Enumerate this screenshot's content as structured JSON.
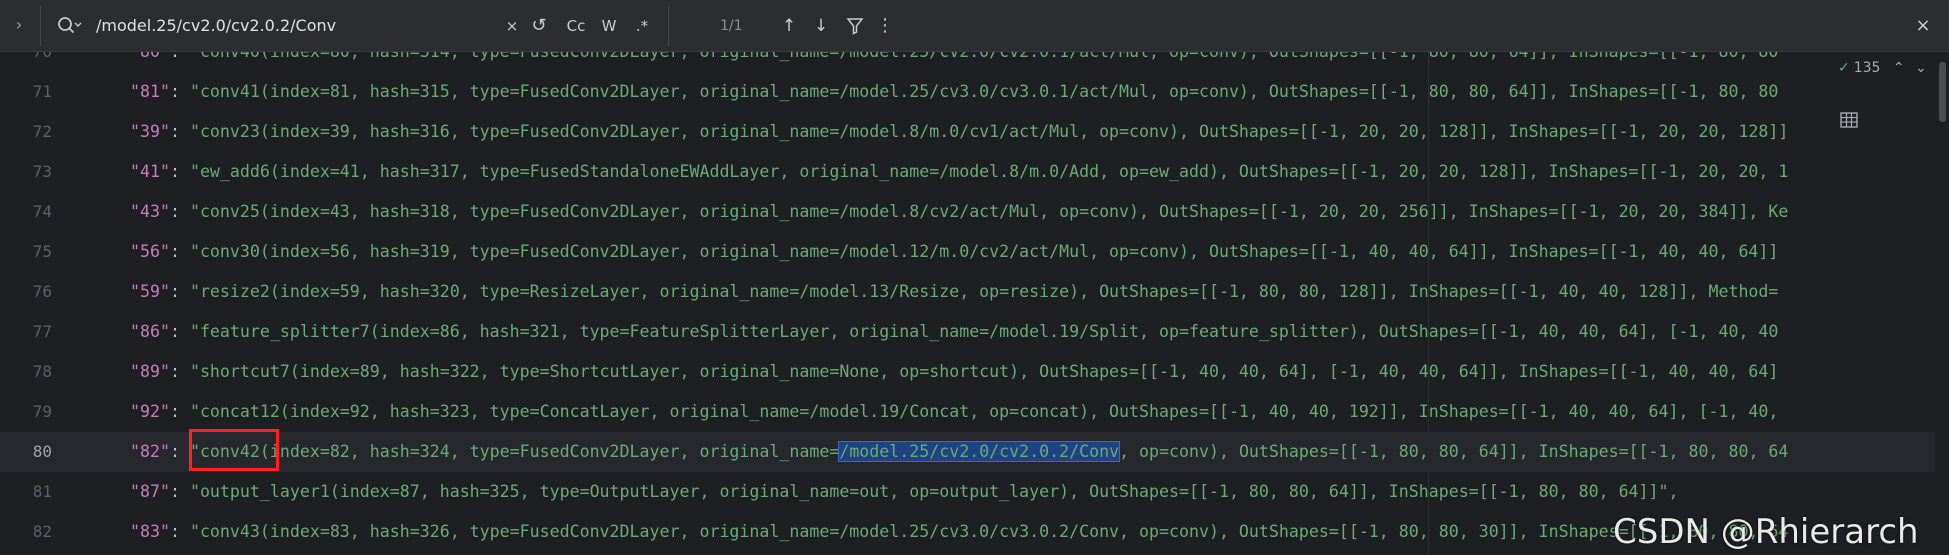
{
  "search": {
    "query": "/model.25/cv2.0/cv2.0.2/Conv",
    "clear_label": "×",
    "replace_label": "↺",
    "case_label": "Cc",
    "word_label": "W",
    "regex_label": ".*",
    "match_count": "1/1",
    "prev_label": "↑",
    "next_label": "↓",
    "filter_label": "⚲",
    "more_label": "⋮",
    "close_label": "×",
    "toggle_label": "›"
  },
  "inspection": {
    "count": "135"
  },
  "lines": [
    {
      "n": "70",
      "key": "\"80\"",
      "val": "\"conv40(index=80, hash=314, type=FusedConv2DLayer, original_name=/model.25/cv2.0/cv2.0.1/act/Mul, op=conv), OutShapes=[[-1, 80, 80, 64]], InShapes=[[-1, 80, 80"
    },
    {
      "n": "71",
      "key": "\"81\"",
      "val": "\"conv41(index=81, hash=315, type=FusedConv2DLayer, original_name=/model.25/cv3.0/cv3.0.1/act/Mul, op=conv), OutShapes=[[-1, 80, 80, 64]], InShapes=[[-1, 80, 80"
    },
    {
      "n": "72",
      "key": "\"39\"",
      "val": "\"conv23(index=39, hash=316, type=FusedConv2DLayer, original_name=/model.8/m.0/cv1/act/Mul, op=conv), OutShapes=[[-1, 20, 20, 128]], InShapes=[[-1, 20, 20, 128]]"
    },
    {
      "n": "73",
      "key": "\"41\"",
      "val": "\"ew_add6(index=41, hash=317, type=FusedStandaloneEWAddLayer, original_name=/model.8/m.0/Add, op=ew_add), OutShapes=[[-1, 20, 20, 128]], InShapes=[[-1, 20, 20, 1"
    },
    {
      "n": "74",
      "key": "\"43\"",
      "val": "\"conv25(index=43, hash=318, type=FusedConv2DLayer, original_name=/model.8/cv2/act/Mul, op=conv), OutShapes=[[-1, 20, 20, 256]], InShapes=[[-1, 20, 20, 384]], Ke"
    },
    {
      "n": "75",
      "key": "\"56\"",
      "val": "\"conv30(index=56, hash=319, type=FusedConv2DLayer, original_name=/model.12/m.0/cv2/act/Mul, op=conv), OutShapes=[[-1, 40, 40, 64]], InShapes=[[-1, 40, 40, 64]]"
    },
    {
      "n": "76",
      "key": "\"59\"",
      "val": "\"resize2(index=59, hash=320, type=ResizeLayer, original_name=/model.13/Resize, op=resize), OutShapes=[[-1, 80, 80, 128]], InShapes=[[-1, 40, 40, 128]], Method="
    },
    {
      "n": "77",
      "key": "\"86\"",
      "val": "\"feature_splitter7(index=86, hash=321, type=FeatureSplitterLayer, original_name=/model.19/Split, op=feature_splitter), OutShapes=[[-1, 40, 40, 64], [-1, 40, 40"
    },
    {
      "n": "78",
      "key": "\"89\"",
      "val": "\"shortcut7(index=89, hash=322, type=ShortcutLayer, original_name=None, op=shortcut), OutShapes=[[-1, 40, 40, 64], [-1, 40, 40, 64]], InShapes=[[-1, 40, 40, 64]"
    },
    {
      "n": "79",
      "key": "\"92\"",
      "val": "\"concat12(index=92, hash=323, type=ConcatLayer, original_name=/model.19/Concat, op=concat), OutShapes=[[-1, 40, 40, 192]], InShapes=[[-1, 40, 40, 64], [-1, 40,"
    },
    {
      "n": "80",
      "key": "\"82\"",
      "val_pre": "\"conv42(index=82, hash=324, type=FusedConv2DLayer, original_name=",
      "val_match": "/model.25/cv2.0/cv2.0.2/Conv",
      "val_post": ", op=conv), OutShapes=[[-1, 80, 80, 64]], InShapes=[[-1, 80, 80, 64"
    },
    {
      "n": "81",
      "key": "\"87\"",
      "val": "\"output_layer1(index=87, hash=325, type=OutputLayer, original_name=out, op=output_layer), OutShapes=[[-1, 80, 80, 64]], InShapes=[[-1, 80, 80, 64]]\","
    },
    {
      "n": "82",
      "key": "\"83\"",
      "val": "\"conv43(index=83, hash=326, type=FusedConv2DLayer, original_name=/model.25/cv3.0/cv3.0.2/Conv, op=conv), OutShapes=[[-1, 80, 80, 30]], InShapes=[[-1, 80, 80, 64"
    }
  ],
  "watermark": "CSDN @Rhierarch"
}
